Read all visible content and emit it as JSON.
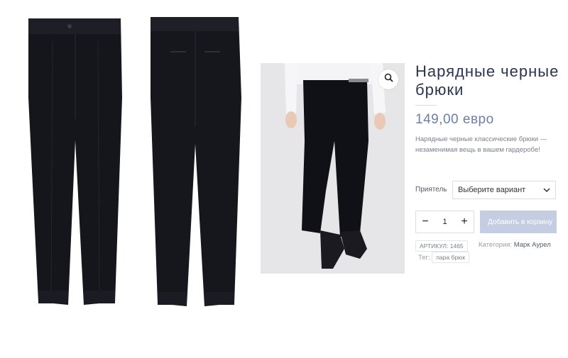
{
  "product": {
    "title": "Нарядные черные брюки",
    "price": "149,00 евро",
    "description": "Нарядные черные классические брюки — незаменимая вещь в вашем гардеробе!"
  },
  "variant": {
    "label": "Приятель",
    "selected": "Выберите вариант"
  },
  "quantity": {
    "value": "1",
    "minus": "−",
    "plus": "+"
  },
  "cart": {
    "add_label": "Добавить в корзину"
  },
  "meta": {
    "sku_label": "АРТИКУЛ:",
    "sku_value": "1465",
    "category_label": "Категория:",
    "category_value": "Марк Аурел",
    "tags_label": "Тег:",
    "tag_value": "пара брюк"
  },
  "icons": {
    "zoom": "magnifier-icon",
    "select": "chevron-down-icon"
  },
  "colors": {
    "accent": "#c5cde3",
    "price": "#6d7fa3",
    "title": "#2a3552"
  }
}
